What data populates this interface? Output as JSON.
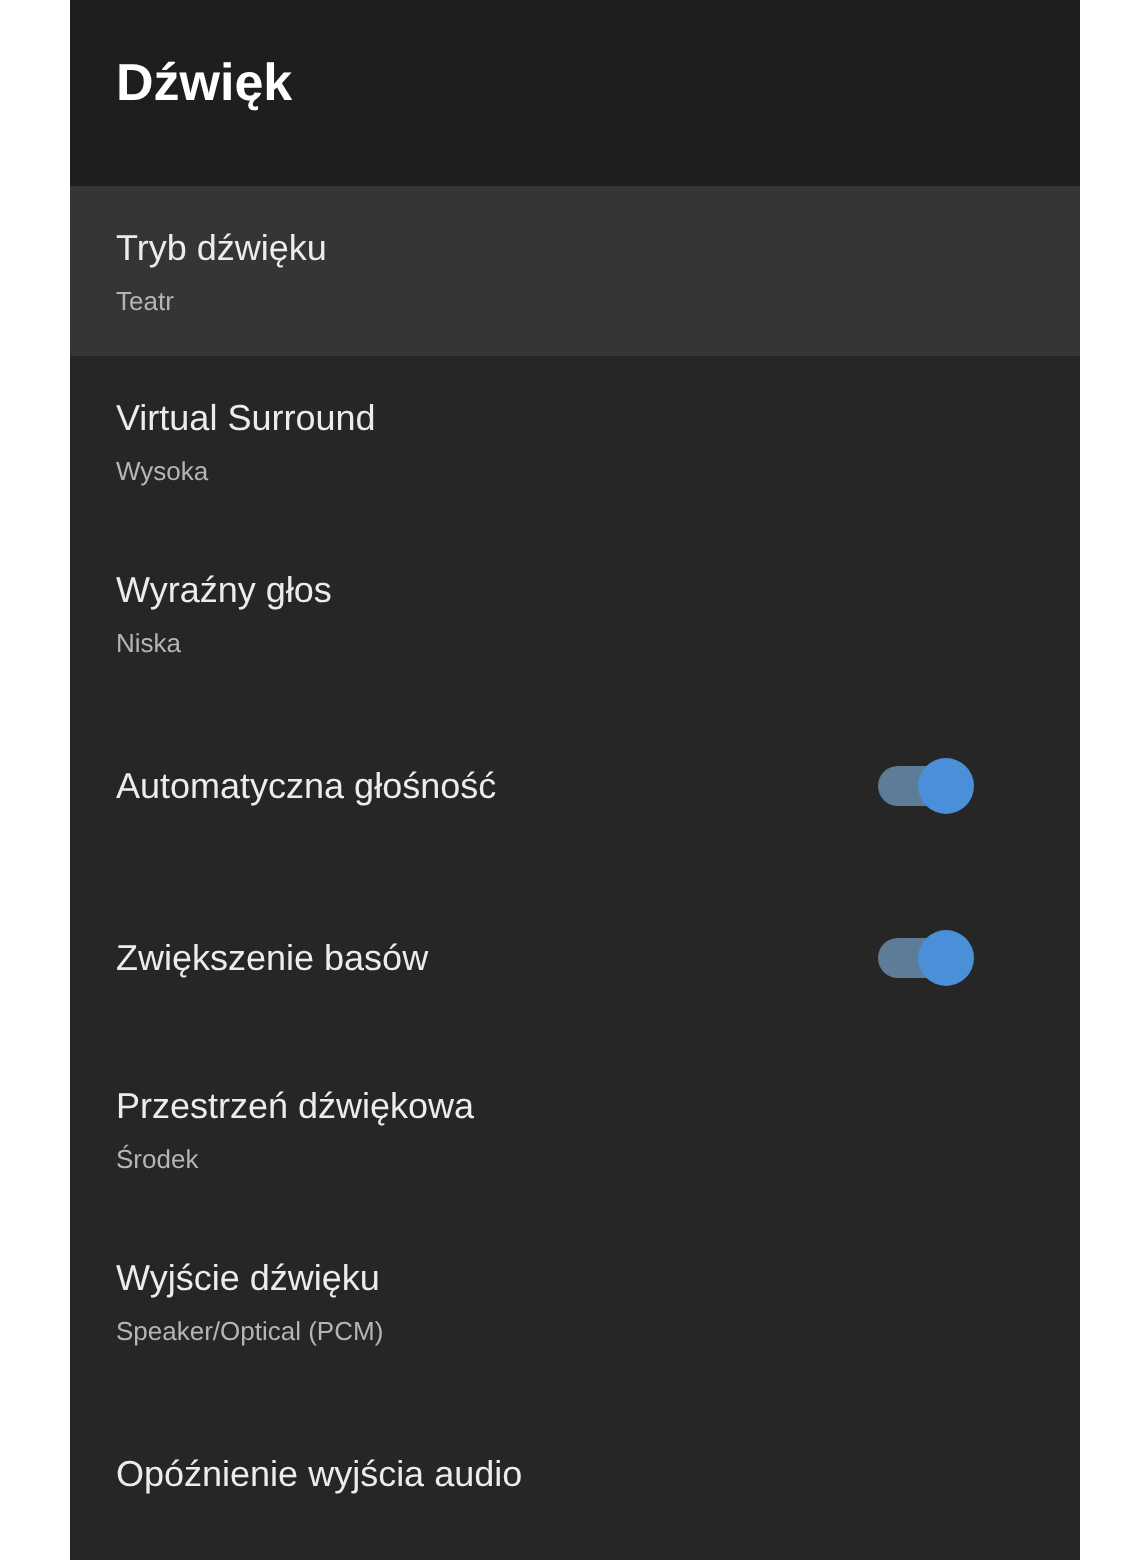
{
  "header": {
    "title": "Dźwięk"
  },
  "items": [
    {
      "kind": "detail",
      "title": "Tryb dźwięku",
      "value": "Teatr",
      "selected": true
    },
    {
      "kind": "detail",
      "title": "Virtual Surround",
      "value": "Wysoka",
      "selected": false
    },
    {
      "kind": "detail",
      "title": "Wyraźny głos",
      "value": "Niska",
      "selected": false
    },
    {
      "kind": "toggle",
      "title": "Automatyczna głośność",
      "on": true,
      "selected": false
    },
    {
      "kind": "toggle",
      "title": "Zwiększenie basów",
      "on": true,
      "selected": false
    },
    {
      "kind": "detail",
      "title": "Przestrzeń dźwiękowa",
      "value": "Środek",
      "selected": false
    },
    {
      "kind": "detail",
      "title": "Wyjście dźwięku",
      "value": "Speaker/Optical (PCM)",
      "selected": false
    },
    {
      "kind": "plain",
      "title": "Opóźnienie wyjścia audio",
      "selected": false
    }
  ]
}
